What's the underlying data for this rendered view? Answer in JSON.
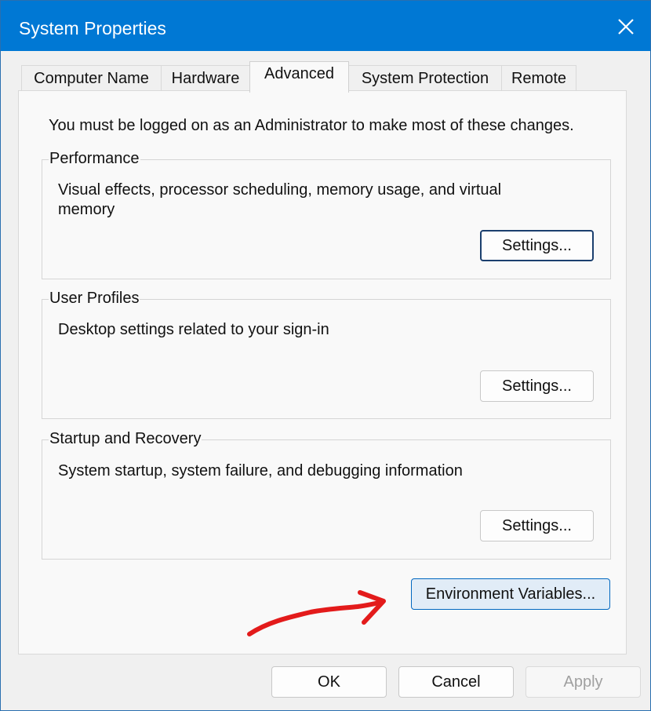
{
  "window": {
    "title": "System Properties"
  },
  "tabs": [
    {
      "label": "Computer Name"
    },
    {
      "label": "Hardware"
    },
    {
      "label": "Advanced"
    },
    {
      "label": "System Protection"
    },
    {
      "label": "Remote"
    }
  ],
  "active_tab": "Advanced",
  "admin_note": "You must be logged on as an Administrator to make most of these changes.",
  "groups": [
    {
      "title": "Performance",
      "description": "Visual effects, processor scheduling, memory usage, and virtual memory",
      "button_label": "Settings..."
    },
    {
      "title": "User Profiles",
      "description": "Desktop settings related to your sign-in",
      "button_label": "Settings..."
    },
    {
      "title": "Startup and Recovery",
      "description": "System startup, system failure, and debugging information",
      "button_label": "Settings..."
    }
  ],
  "env_button": {
    "label": "Environment Variables..."
  },
  "footer": {
    "ok": "OK",
    "cancel": "Cancel",
    "apply": "Apply"
  },
  "colors": {
    "titlebar": "#0078d4",
    "annotation_arrow": "#e31b1b"
  },
  "icons": {
    "close": "close-icon",
    "annotation": "arrow-annotation"
  }
}
